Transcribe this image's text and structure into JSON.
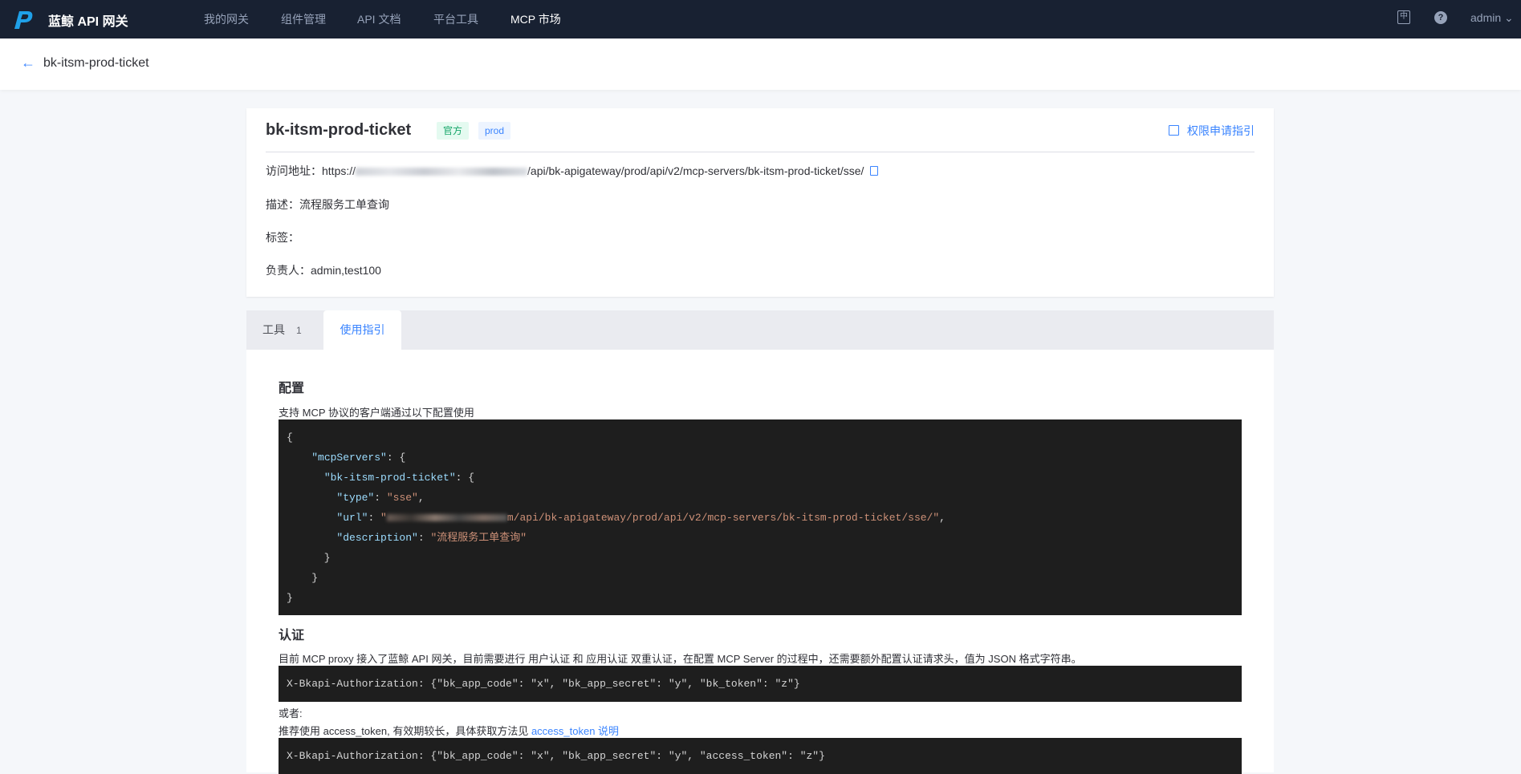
{
  "header": {
    "brand": "蓝鲸 API 网关",
    "nav": [
      "我的网关",
      "组件管理",
      "API 文档",
      "平台工具",
      "MCP 市场"
    ],
    "active_nav": 4,
    "user": "admin"
  },
  "subheader": {
    "title": "bk-itsm-prod-ticket"
  },
  "card": {
    "title": "bk-itsm-prod-ticket",
    "tags": [
      "官方",
      "prod"
    ],
    "perm_link": "权限申请指引",
    "url_label": "访问地址：",
    "url_prefix": "https://",
    "url_suffix": "/api/bk-apigateway/prod/api/v2/mcp-servers/bk-itsm-prod-ticket/sse/",
    "desc_label": "描述：",
    "desc": "流程服务工单查询",
    "labels_label": "标签：",
    "owner_label": "负责人：",
    "owner": "admin,test100"
  },
  "tabs": [
    {
      "label": "工具",
      "count": "1"
    },
    {
      "label": "使用指引"
    }
  ],
  "guide": {
    "config_title": "配置",
    "config_desc": "支持 MCP 协议的客户端通过以下配置使用",
    "code": {
      "open": "{",
      "mcp_key": "\"mcpServers\"",
      "server_key": "\"bk-itsm-prod-ticket\"",
      "type_key": "\"type\"",
      "type_val": "\"sse\"",
      "url_key": "\"url\"",
      "url_open": "\"",
      "url_tail": "m/api/bk-apigateway/prod/api/v2/mcp-servers/bk-itsm-prod-ticket/sse/\"",
      "desc_key": "\"description\"",
      "desc_val": "\"流程服务工单查询\""
    },
    "auth_title": "认证",
    "auth_desc": "目前 MCP proxy 接入了蓝鲸 API 网关，目前需要进行 用户认证 和 应用认证 双重认证，在配置 MCP Server 的过程中，还需要额外配置认证请求头，值为 JSON 格式字符串。",
    "auth_code1": "X-Bkapi-Authorization: {\"bk_app_code\": \"x\", \"bk_app_secret\": \"y\", \"bk_token\": \"z\"}",
    "or": "或者:",
    "recommend": "推荐使用 access_token, 有效期较长，具体获取方法见",
    "recommend_link": "access_token 说明",
    "auth_code2": "X-Bkapi-Authorization: {\"bk_app_code\": \"x\", \"bk_app_secret\": \"y\", \"access_token\": \"z\"}"
  },
  "colors": {
    "topbar": "#182132",
    "accent": "#3a84ff",
    "code_bg": "#1e1e1e"
  }
}
